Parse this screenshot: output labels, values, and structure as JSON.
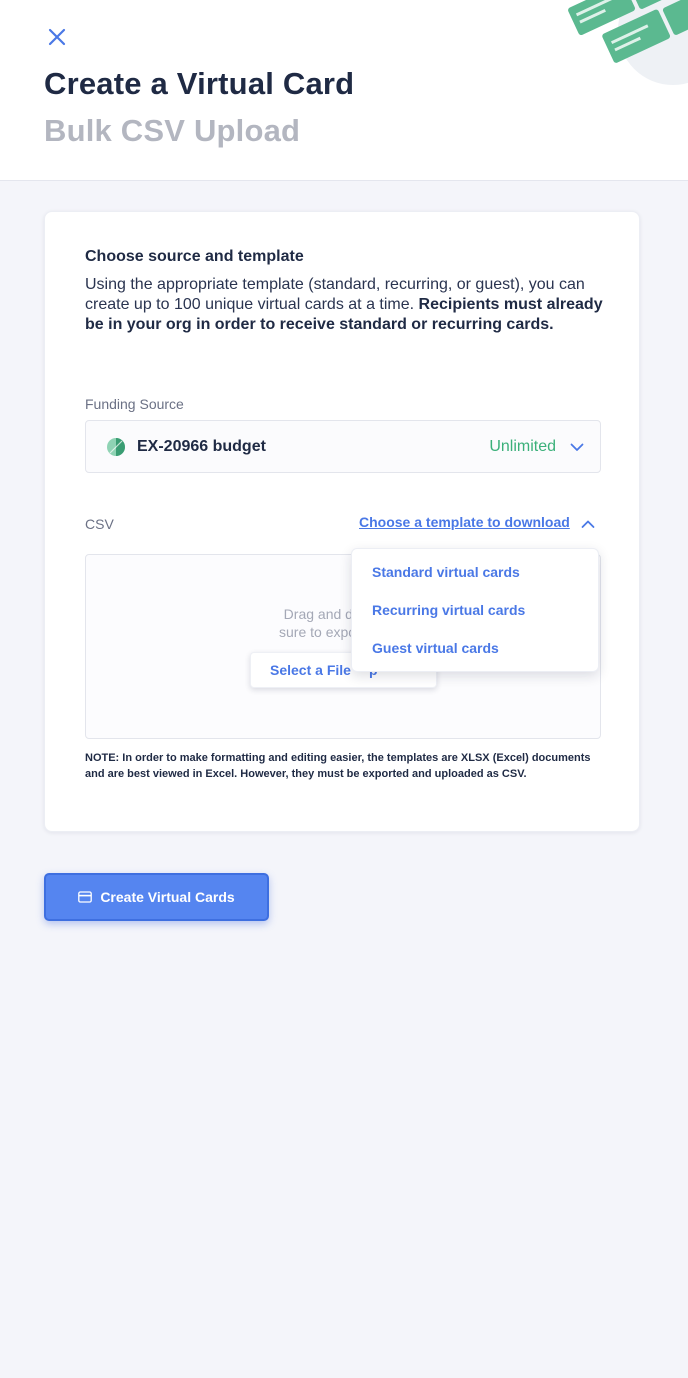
{
  "header": {
    "title": "Create a Virtual Card",
    "subtitle": "Bulk CSV Upload",
    "close_icon": "close-icon"
  },
  "form": {
    "section_title": "Choose source and template",
    "description_plain": "Using the appropriate template (standard, recurring, or guest), you can create up to 100 unique virtual cards at a time. ",
    "description_bold": "Recipients must already be in your org in order to receive standard or recurring cards.",
    "funding": {
      "label": "Funding Source",
      "selected_name": "EX-20966 budget",
      "limit": "Unlimited",
      "icon": "budget-pie-icon",
      "chevron_icon": "chevron-down-icon"
    },
    "csv": {
      "label": "CSV",
      "template_link": "Choose a template to download",
      "chevron_icon": "chevron-up-icon",
      "drop_text_line1": "Drag and drop your",
      "drop_text_line2": "sure to export your X",
      "select_file_label": "Select a File",
      "select_file_suffix": "p"
    },
    "note": "NOTE: In order to make formatting and editing easier, the templates are XLSX (Excel) documents and are best viewed in Excel. However, they must be exported and uploaded as CSV."
  },
  "template_menu": {
    "items": [
      "Standard virtual cards",
      "Recurring virtual cards",
      "Guest virtual cards"
    ]
  },
  "actions": {
    "create_label": "Create Virtual Cards",
    "create_icon": "credit-card-icon"
  },
  "colors": {
    "accent": "#4a78e6",
    "primary_button": "#5585f0",
    "success": "#3bb07a",
    "title": "#1f2a44",
    "subtitle": "#b3b6c0",
    "background": "#f4f5fa"
  }
}
